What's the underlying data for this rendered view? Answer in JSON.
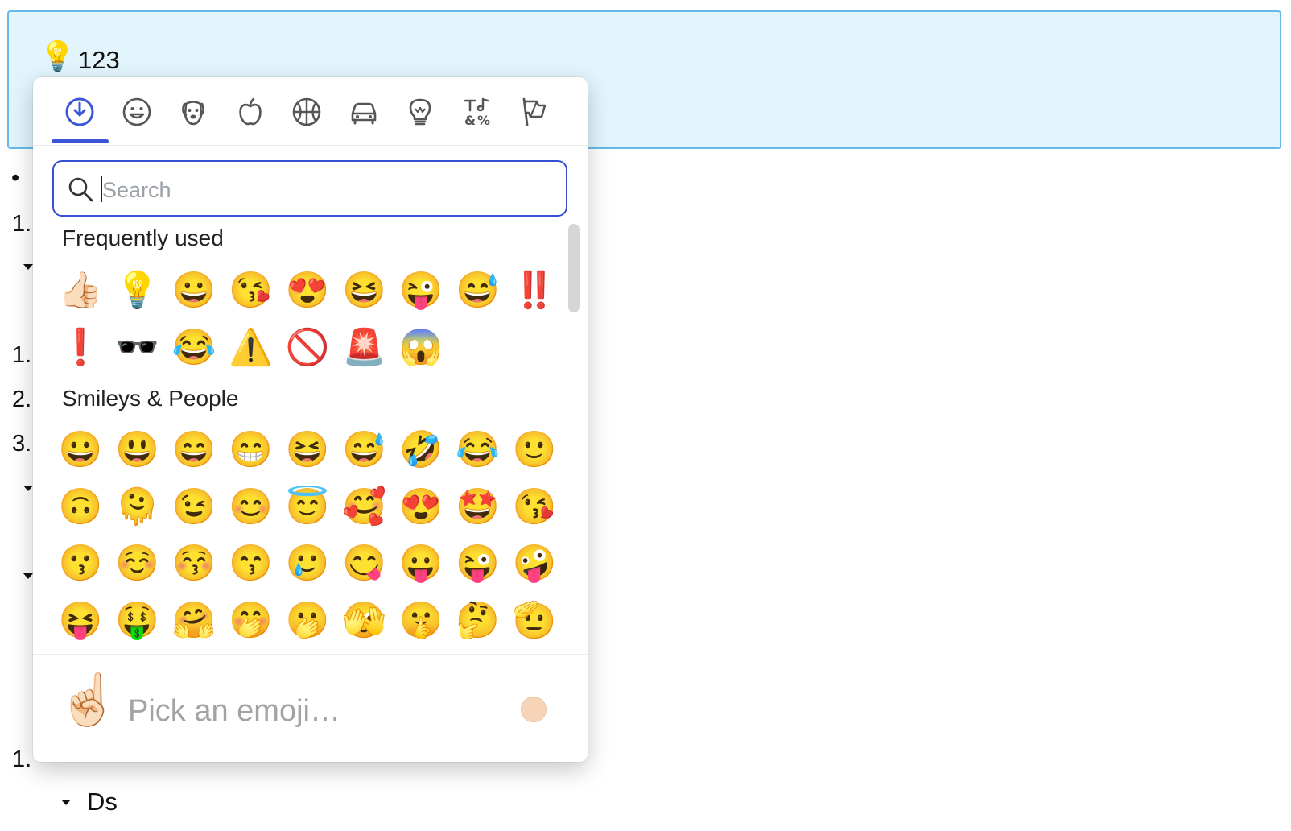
{
  "callout": {
    "icon": "💡",
    "text": "123"
  },
  "document": {
    "markers": [
      "•",
      "1.",
      "1.",
      "2.",
      "3.",
      "1."
    ],
    "bottom_item": "Ds"
  },
  "picker": {
    "categories": [
      {
        "name": "recent-icon"
      },
      {
        "name": "smileys-icon"
      },
      {
        "name": "animals-icon"
      },
      {
        "name": "food-icon"
      },
      {
        "name": "activity-icon"
      },
      {
        "name": "travel-icon"
      },
      {
        "name": "objects-icon"
      },
      {
        "name": "symbols-icon"
      },
      {
        "name": "flags-icon"
      }
    ],
    "active_category": "recent",
    "accent_color": "#3a56d6",
    "search": {
      "placeholder": "Search",
      "value": ""
    },
    "sections": [
      {
        "title": "Frequently used",
        "emojis": [
          "👍🏻",
          "💡",
          "😀",
          "😘",
          "😍",
          "😆",
          "😜",
          "😅",
          "‼️",
          "❗",
          "🕶️",
          "😂",
          "⚠️",
          "🚫",
          "🚨",
          "😱"
        ]
      },
      {
        "title": "Smileys & People",
        "emojis": [
          "😀",
          "😃",
          "😄",
          "😁",
          "😆",
          "😅",
          "🤣",
          "😂",
          "🙂",
          "🙃",
          "🫠",
          "😉",
          "😊",
          "😇",
          "🥰",
          "😍",
          "🤩",
          "😘",
          "😗",
          "☺️",
          "😚",
          "😙",
          "🥲",
          "😋",
          "😛",
          "😜",
          "🤪",
          "😝",
          "🤑",
          "🤗",
          "🤭",
          "🫢",
          "🫣",
          "🤫",
          "🤔",
          "🫡"
        ]
      }
    ],
    "footer": {
      "preview_emoji": "☝🏻",
      "text": "Pick an emoji…",
      "skin_tone_color": "#f7d4b7"
    }
  }
}
